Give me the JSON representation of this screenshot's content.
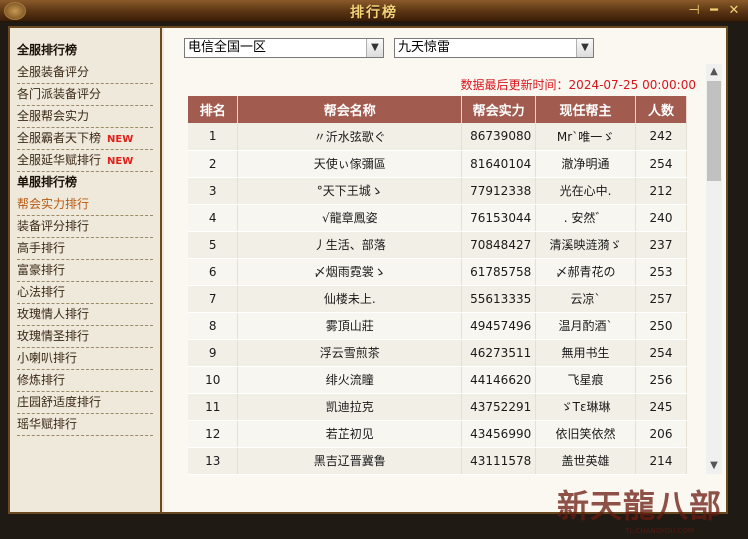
{
  "window": {
    "title": "排行榜",
    "buttons": [
      "pin",
      "minimize",
      "close"
    ]
  },
  "sidebar": {
    "items": [
      {
        "label": "全服排行榜",
        "type": "header"
      },
      {
        "label": "全服装备评分"
      },
      {
        "label": "各门派装备评分"
      },
      {
        "label": "全服帮会实力"
      },
      {
        "label": "全服霸者天下榜",
        "badge": "NEW"
      },
      {
        "label": "全服延华赋排行",
        "badge": "NEW"
      },
      {
        "label": "单服排行榜",
        "type": "header"
      },
      {
        "label": "帮会实力排行",
        "active": true
      },
      {
        "label": "装备评分排行"
      },
      {
        "label": "高手排行"
      },
      {
        "label": "富豪排行"
      },
      {
        "label": "心法排行"
      },
      {
        "label": "玫瑰情人排行"
      },
      {
        "label": "玫瑰情圣排行"
      },
      {
        "label": "小喇叭排行"
      },
      {
        "label": "修炼排行"
      },
      {
        "label": "庄园舒适度排行"
      },
      {
        "label": "瑶华赋排行"
      }
    ]
  },
  "filters": {
    "region": "电信全国一区",
    "server": "九天惊雷"
  },
  "updated_text": "数据最后更新时间：2024-07-25 00:00:00",
  "table": {
    "headers": [
      "排名",
      "帮会名称",
      "帮会实力",
      "现任帮主",
      "人数"
    ],
    "rows": [
      [
        "1",
        "〃沂水弦歌ぐ",
        "86739080",
        "Mr`唯一ゞ",
        "242"
      ],
      [
        "2",
        "天使ぃ傢彌區",
        "81640104",
        "澈净明通",
        "254"
      ],
      [
        "3",
        "°天下王城ゝ",
        "77912338",
        "光在心中.",
        "212"
      ],
      [
        "4",
        "√龍章鳳姿",
        "76153044",
        ". 安然゛",
        "240"
      ],
      [
        "5",
        "丿生活、部落",
        "70848427",
        "清溪映涟漪ゞ",
        "237"
      ],
      [
        "6",
        "〆烟雨霓裳ゝ",
        "61785758",
        "〆郝青花の",
        "253"
      ],
      [
        "7",
        "仙楼未上.",
        "55613335",
        "云凉`",
        "257"
      ],
      [
        "8",
        "雾頂山莊",
        "49457496",
        "温月酌酒`",
        "250"
      ],
      [
        "9",
        "浮云雪煎茶",
        "46273511",
        "無用书生",
        "254"
      ],
      [
        "10",
        "绯火流瞳",
        "44146620",
        "飞星痕",
        "256"
      ],
      [
        "11",
        "凯迪拉克",
        "43752291",
        "ゞTε琳琳",
        "245"
      ],
      [
        "12",
        "若芷初见",
        "43456990",
        "依旧笑依然",
        "206"
      ],
      [
        "13",
        "黑吉辽晋冀鲁",
        "43111578",
        "盖世英雄",
        "214"
      ]
    ]
  },
  "watermark": {
    "logo": "新天龍八部",
    "site": "TL.CHANGYOU.COM"
  },
  "colors": {
    "header_bg": "#a15b4f",
    "update_text": "#d8151d",
    "active_item": "#b85a12",
    "new_badge": "#e0201a"
  }
}
